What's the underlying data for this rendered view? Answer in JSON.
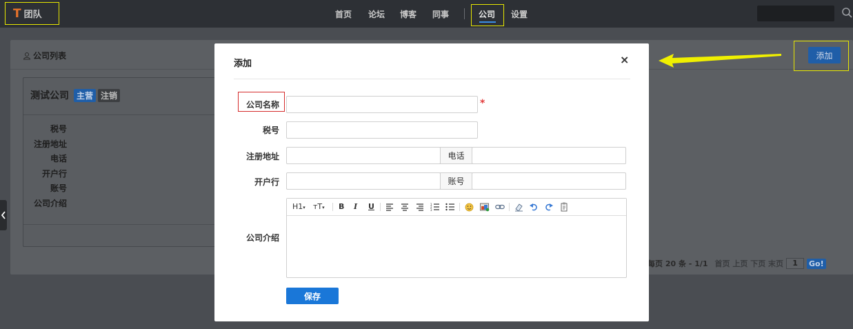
{
  "brand": {
    "logo_letter": "T",
    "name": "团队",
    "logo_color": "#e8732a"
  },
  "nav": {
    "items": [
      "首页",
      "论坛",
      "博客",
      "同事",
      "公司",
      "设置"
    ],
    "active": "公司"
  },
  "search": {
    "placeholder": ""
  },
  "panel": {
    "title": "公司列表",
    "add_button": "添加"
  },
  "company_card": {
    "name": "测试公司",
    "badges": [
      "主营",
      "注销"
    ],
    "fields": [
      "税号",
      "注册地址",
      "电话",
      "开户行",
      "账号",
      "公司介绍"
    ]
  },
  "pagination": {
    "text": "，每页 20 条 - 1/1",
    "links": "首页 上页 下页 末页",
    "page_value": "1",
    "go": "Go!"
  },
  "modal": {
    "title": "添加",
    "close": "×",
    "labels": {
      "company_name": "公司名称",
      "tax_id": "税号",
      "address": "注册地址",
      "phone": "电话",
      "bank": "开户行",
      "account": "账号",
      "intro": "公司介绍"
    },
    "values": {
      "company_name": "",
      "tax_id": "",
      "address": "",
      "phone": "",
      "bank": "",
      "account": "",
      "intro": ""
    },
    "required_mark": "*",
    "save": "保存",
    "toolbar": {
      "h1": "H1",
      "font_size": "тT",
      "bold": "B",
      "italic": "I",
      "underline": "U"
    }
  },
  "colors": {
    "primary": "#1a77d8",
    "highlight": "#e8e800",
    "required": "#e23a3a"
  }
}
